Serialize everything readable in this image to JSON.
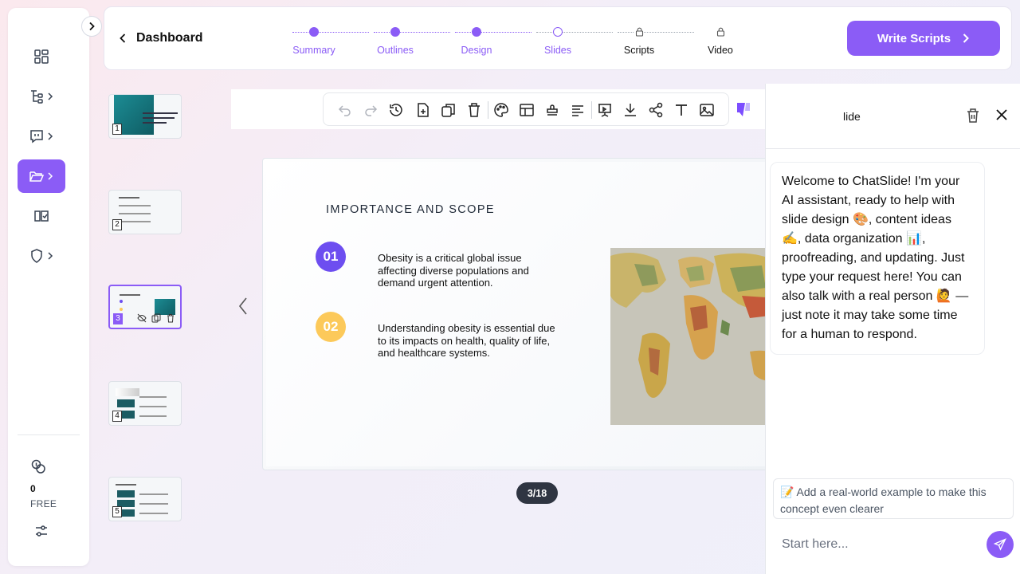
{
  "header": {
    "back_label": "Dashboard",
    "steps": [
      {
        "label": "Summary",
        "state": "done"
      },
      {
        "label": "Outlines",
        "state": "done"
      },
      {
        "label": "Design",
        "state": "done"
      },
      {
        "label": "Slides",
        "state": "current"
      },
      {
        "label": "Scripts",
        "state": "locked"
      },
      {
        "label": "Video",
        "state": "locked"
      }
    ],
    "primary_button": "Write Scripts"
  },
  "sidebar": {
    "credits": "0",
    "plan": "FREE"
  },
  "thumbnails": [
    "1",
    "2",
    "3",
    "4",
    "5"
  ],
  "slide": {
    "title": "IMPORTANCE AND SCOPE",
    "points": [
      {
        "number": "01",
        "text": "Obesity is a critical global issue affecting diverse populations and demand urgent attention.",
        "color": "#6d4ef0"
      },
      {
        "number": "02",
        "text": "Understanding obesity is essential due to its impacts on health, quality of life, and healthcare systems.",
        "color": "#fcc95a"
      }
    ]
  },
  "page_indicator": "3/18",
  "chat": {
    "title": "lide",
    "welcome": "Welcome to ChatSlide! I'm your AI assistant, ready to help with slide design 🎨, content ideas ✍️, data organization 📊, proofreading, and updating. Just type your request here! You can also talk with a real person 🙋 — just note it may take some time for a human to respond.",
    "suggestion": "📝 Add a real-world example to make this concept even clearer",
    "input_placeholder": "Start here..."
  },
  "colors": {
    "accent": "#8b5cf6",
    "badge_1": "#6d4ef0",
    "badge_2": "#fcc95a"
  }
}
